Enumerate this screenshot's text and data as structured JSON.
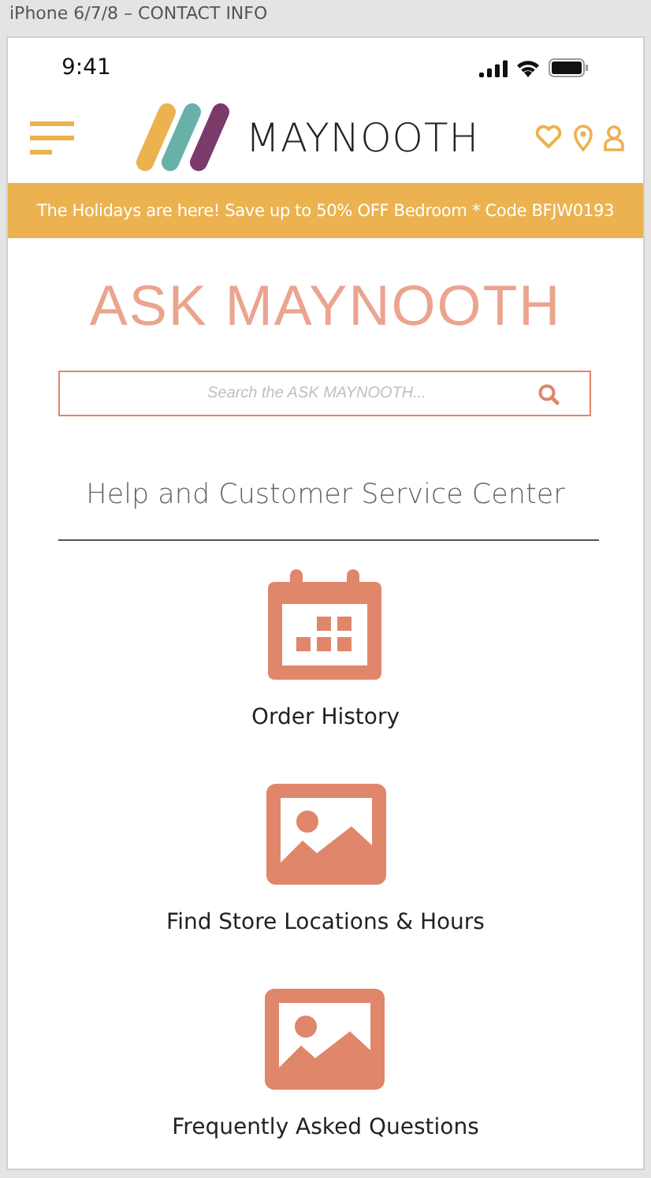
{
  "frame_title": "iPhone 6/7/8 – CONTACT INFO",
  "status_bar": {
    "time": "9:41"
  },
  "header": {
    "brand": "MAYNOOTH"
  },
  "promo_banner": "The Holidays are here! Save up to 50% OFF Bedroom * Code BFJW0193",
  "page_title": "ASK MAYNOOTH",
  "search": {
    "placeholder": "Search the ASK MAYNOOTH..."
  },
  "section_heading": "Help and Customer Service Center",
  "links": [
    {
      "kind": "calendar",
      "label": "Order History"
    },
    {
      "kind": "image",
      "label": "Find Store Locations & Hours"
    },
    {
      "kind": "image",
      "label": "Frequently Asked Questions"
    }
  ]
}
